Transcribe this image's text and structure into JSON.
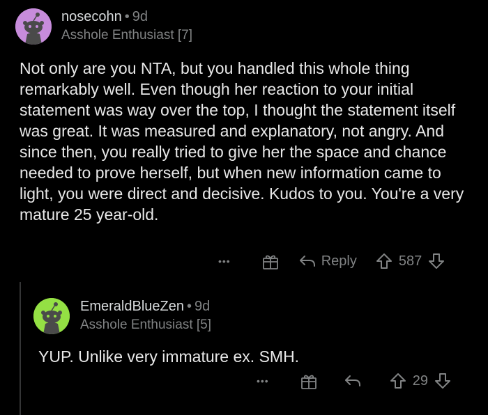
{
  "comments": [
    {
      "username": "nosecohn",
      "separator": "•",
      "age": "9d",
      "flair": "Asshole Enthusiast [7]",
      "avatar_color": "#c78cdb",
      "body": "Not only are you NTA, but you handled this whole thing remarkably well. Even though her reaction to your initial statement was way over the top, I thought the statement itself was great. It was measured and explanatory, not angry. And since then, you really tried to give her the space and chance needed to prove herself, but when new information came to light, you were direct and decisive. Kudos to you. You're a very mature 25 year-old.",
      "more_label": "•••",
      "reply_label": "Reply",
      "score": "587"
    },
    {
      "username": "EmeraldBlueZen",
      "separator": "•",
      "age": "9d",
      "flair": "Asshole Enthusiast [5]",
      "avatar_color": "#94e044",
      "body": "YUP. Unlike very immature ex. SMH.",
      "more_label": "•••",
      "score": "29"
    }
  ],
  "icons": [
    "snoo-avatar-icon",
    "more-options-icon",
    "award-gift-icon",
    "reply-arrow-icon",
    "upvote-icon",
    "downvote-icon"
  ],
  "colors": {
    "background": "#000000",
    "text": "#d7dadc",
    "muted": "#818384",
    "thread_line": "#343536"
  }
}
